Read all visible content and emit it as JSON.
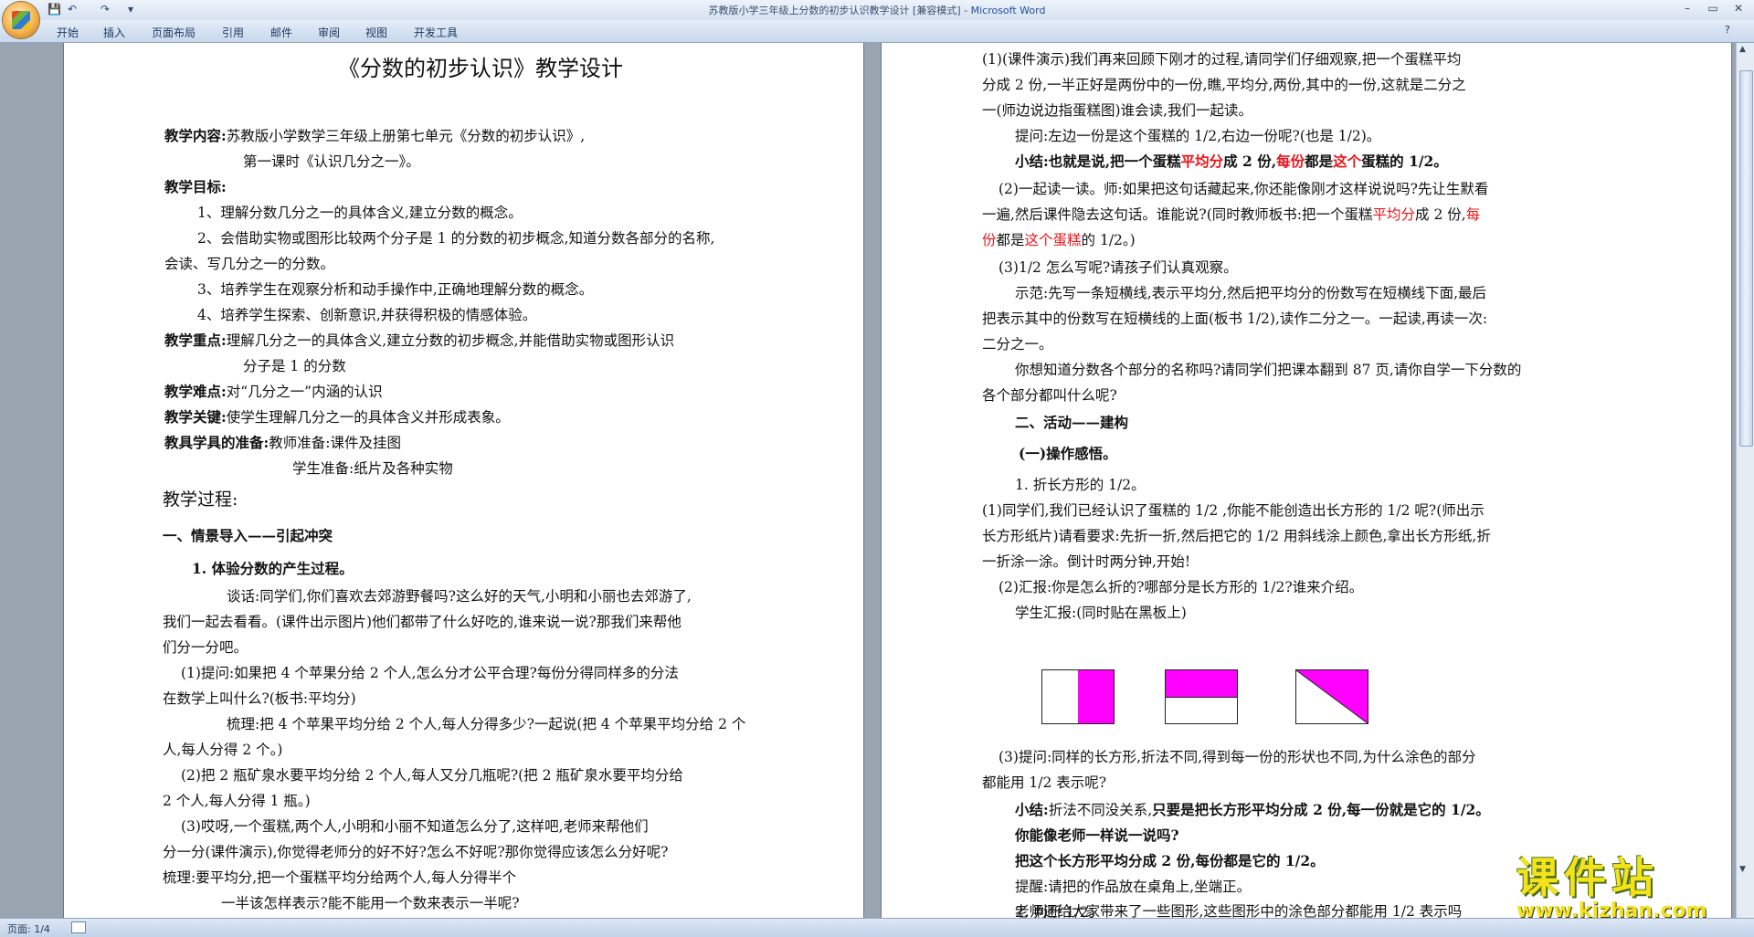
{
  "window": {
    "title": "苏教版小学三年级上分数的初步认识教学设计 [兼容模式] - ",
    "app_name": "Microsoft Word",
    "qat": [
      "💾",
      "↶",
      "↷",
      "▾"
    ],
    "controls": [
      "–",
      "▭",
      "✕"
    ]
  },
  "ribbon": {
    "tabs": [
      "开始",
      "插入",
      "页面布局",
      "引用",
      "邮件",
      "审阅",
      "视图",
      "开发工具"
    ]
  },
  "status": {
    "page": "页面: 1/4"
  },
  "watermark": {
    "text": "课件站",
    "url": "www.kjzhan.com"
  },
  "colors": {
    "magenta": "#ff00ff",
    "red": "#e8151b"
  },
  "page1": {
    "title": "《分数的初步认识》教学设计",
    "lines": [
      {
        "lbl": "教学内容:",
        "txt": "苏教版小学数学三年级上册第七单元《分数的初步认识》,"
      },
      {
        "lbl": "",
        "txt": "第一课时《认识几分之一》。"
      },
      {
        "lbl": "教学目标:",
        "txt": ""
      },
      {
        "lbl": "",
        "txt": "1、理解分数几分之一的具体含义,建立分数的概念。"
      },
      {
        "lbl": "",
        "txt": "2、会借助实物或图形比较两个分子是 1 的分数的初步概念,知道分数各部分的名称,"
      },
      {
        "lbl": "",
        "txt": "会读、写几分之一的分数。"
      },
      {
        "lbl": "",
        "txt": "3、培养学生在观察分析和动手操作中,正确地理解分数的概念。"
      },
      {
        "lbl": "",
        "txt": "4、培养学生探索、创新意识,并获得积极的情感体验。"
      },
      {
        "lbl": "教学重点:",
        "txt": "理解几分之一的具体含义,建立分数的初步概念,并能借助实物或图形认识"
      },
      {
        "lbl": "",
        "txt": "分子是 1 的分数"
      },
      {
        "lbl": "教学难点:",
        "txt": "对“几分之一”内涵的认识"
      },
      {
        "lbl": "教学关键:",
        "txt": "使学生理解几分之一的具体含义并形成表象。"
      },
      {
        "lbl": "教具学具的准备:",
        "txt": "教师准备:课件及挂图"
      },
      {
        "lbl": "",
        "txt": "学生准备:纸片及各种实物"
      }
    ],
    "process_title": "教学过程:",
    "section1": "一、情景导入——引起冲突",
    "sub1": "1. 体验分数的产生过程。",
    "body": [
      "谈话:同学们,你们喜欢去郊游野餐吗?这么好的天气,小明和小丽也去郊游了,",
      "我们一起去看看。(课件出示图片)他们都带了什么好吃的,谁来说一说?那我们来帮他",
      "们分一分吧。",
      "(1)提问:如果把 4 个苹果分给 2 个人,怎么分才公平合理?每份分得同样多的分法",
      "在数学上叫什么?(板书:平均分)",
      "梳理:把 4 个苹果平均分给 2 个人,每人分得多少?一起说(把 4 个苹果平均分给 2 个",
      "人,每人分得 2 个。)",
      "(2)把 2 瓶矿泉水要平均分给 2 个人,每人又分几瓶呢?(把 2 瓶矿泉水要平均分给",
      "2 个人,每人分得 1 瓶。)",
      "(3)哎呀,一个蛋糕,两个人,小明和小丽不知道怎么分了,这样吧,老师来帮他们",
      "分一分(课件演示),你觉得老师分的好不好?怎么不好呢?那你觉得应该怎么分好呢?",
      "梳理:要平均分,把一个蛋糕平均分给两个人,每人分得半个",
      "一半该怎样表示?能不能用一个数来表示一半呢?"
    ]
  },
  "page2": {
    "body1": [
      "(1)(课件演示)我们再来回顾下刚才的过程,请同学们仔细观察,把一个蛋糕平均",
      "分成 2 份,一半正好是两份中的一份,瞧,平均分,两份,其中的一份,这就是二分之",
      "一(师边说边指蛋糕图)谁会读,我们一起读。",
      "提问:左边一份是这个蛋糕的 1/2,右边一份呢?(也是 1/2)。"
    ],
    "summary1": [
      "小结:也就是说,把一个蛋糕",
      "平均分",
      "成 2 份,",
      "每份",
      "都是",
      "这个",
      "蛋糕的 1/2。"
    ],
    "body2": [
      "(2)一起读一读。师:如果把这句话藏起来,你还能像刚才这样说说吗?先让生默看",
      "一遍,然后课件隐去这句话。谁能说?(同时教师板书:把一个蛋糕",
      "平均分",
      "成 2 份,",
      "每",
      "份",
      "都是",
      "这个蛋糕",
      "的 1/2。)"
    ],
    "body3": [
      "(3)1/2 怎么写呢?请孩子们认真观察。",
      "示范:先写一条短横线,表示平均分,然后把平均分的份数写在短横线下面,最后",
      "把表示其中的份数写在短横线的上面(板书 1/2),读作二分之一。一起读,再读一次:",
      "二分之一。",
      "你想知道分数各个部分的名称吗?请同学们把课本翻到 87 页,请你自学一下分数的",
      "各个部分都叫什么呢?"
    ],
    "section2": "二、活动——建构",
    "sub2": "(一)操作感悟。",
    "body4": [
      "1. 折长方形的 1/2。",
      "(1)同学们,我们已经认识了蛋糕的 1/2 ,你能不能创造出长方形的 1/2 呢?(师出示",
      "长方形纸片)请看要求:先折一折,然后把它的 1/2 用斜线涂上颜色,拿出长方形纸,折",
      "一折涂一涂。倒计时两分钟,开始!",
      "(2)汇报:你是怎么折的?哪部分是长方形的 1/2?谁来介绍。",
      "学生汇报:(同时贴在黑板上)"
    ],
    "body5": [
      "(3)提问:同样的长方形,折法不同,得到每一份的形状也不同,为什么涂色的部分",
      "都能用 1/2 表示呢?"
    ],
    "summary2_lbl": "小结:",
    "summary2_plain": "折法不同没关系,",
    "summary2_bold": "只要是把长方形平均分成 2 份,每一份就是它的 1/2。",
    "bold_lines": [
      "你能像老师一样说一说吗?",
      "把这个长方形平均分成 2 份,每份都是它的 1/2。"
    ],
    "body6": [
      "提醒:请把的作品放在桌角上,坐端正。",
      "2. 判断 1/2。",
      "老师还给大家带来了一些图形,这些图形中的涂色部分都能用 1/2 表示吗"
    ]
  }
}
